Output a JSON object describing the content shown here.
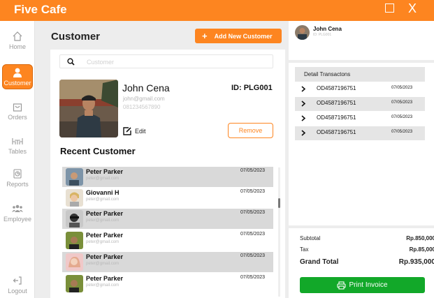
{
  "app": {
    "title": "Five Cafe",
    "maximize_glyph": "☐",
    "close_glyph": "X"
  },
  "sidebar": {
    "items": [
      {
        "label": "Home",
        "icon": "home-icon"
      },
      {
        "label": "Customer",
        "icon": "user-icon",
        "active": true
      },
      {
        "label": "Orders",
        "icon": "bag-icon"
      },
      {
        "label": "Tables",
        "icon": "table-icon"
      },
      {
        "label": "Reports",
        "icon": "report-icon"
      },
      {
        "label": "Employee",
        "icon": "people-icon"
      },
      {
        "label": "Logout",
        "icon": "logout-icon"
      }
    ]
  },
  "main": {
    "title": "Customer",
    "add_button": {
      "plus": "+",
      "label": "Add New Customer"
    },
    "search": {
      "placeholder": "Customer",
      "value": ""
    },
    "profile": {
      "name": "John Cena",
      "email": "john@gmail.com",
      "phone": "081234567890",
      "id": "ID: PLG001",
      "edit_label": "Edit",
      "remove_label": "Remove"
    },
    "recent_title": "Recent Customer",
    "recent": [
      {
        "name": "Peter Parker",
        "email": "peter@gmail.com",
        "date": "07/05/2023",
        "highlight": true
      },
      {
        "name": "Giovanni H",
        "email": "peter@gmail.com",
        "date": "07/05/2023",
        "highlight": false
      },
      {
        "name": "Peter Parker",
        "email": "peter@gmail.com",
        "date": "07/05/2023",
        "highlight": true
      },
      {
        "name": "Peter Parker",
        "email": "peter@gmail.com",
        "date": "07/05/2023",
        "highlight": false
      },
      {
        "name": "Peter Parker",
        "email": "peter@gmail.com",
        "date": "07/05/2023",
        "highlight": true
      },
      {
        "name": "Peter Parker",
        "email": "peter@gmail.com",
        "date": "07/05/2023",
        "highlight": false
      }
    ]
  },
  "right_panel": {
    "user": {
      "name": "John Cena",
      "id": "ID: PLG001"
    },
    "transactions_header": "Detail Transactons",
    "transactions": [
      {
        "id": "OD4587196751",
        "date": "07/05/2023",
        "highlight": false
      },
      {
        "id": "OD4587196751",
        "date": "07/05/2023",
        "highlight": true
      },
      {
        "id": "OD4587196751",
        "date": "07/05/2023",
        "highlight": false
      },
      {
        "id": "OD4587196751",
        "date": "07/05/2023",
        "highlight": true
      }
    ],
    "summary": {
      "subtotal_label": "Subtotal",
      "subtotal": "Rp.850,000",
      "tax_label": "Tax",
      "tax": "Rp.85,000",
      "total_label": "Grand Total",
      "total": "Rp.935,000"
    },
    "print_label": "Print Invoice"
  },
  "colors": {
    "accent": "#fd8520",
    "success": "#12a829",
    "row_highlight": "#d9d9d9"
  }
}
